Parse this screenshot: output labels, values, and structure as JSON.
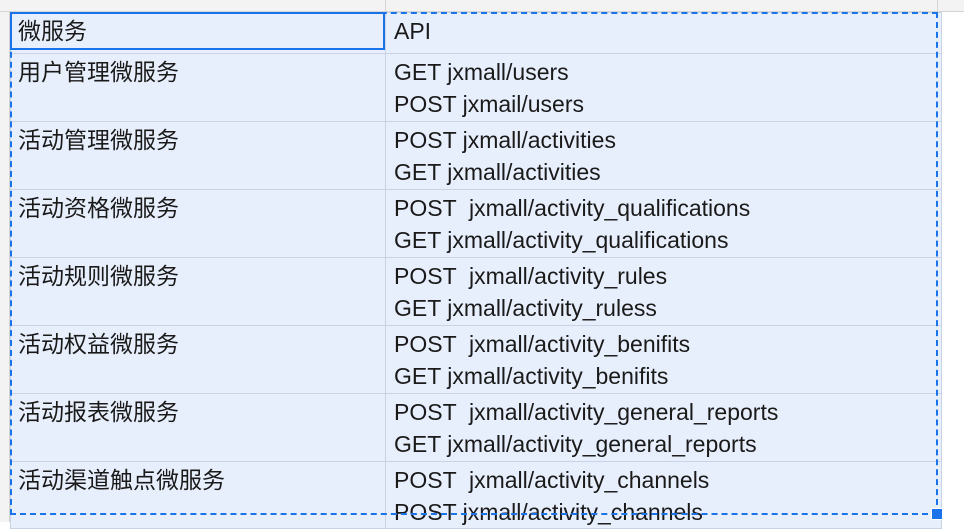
{
  "sheet": {
    "accent_color": "#1a73e8",
    "selection_fill": "#e8effc",
    "header": {
      "col_a": "微服务",
      "col_b": "API"
    },
    "rows": [
      {
        "name": "用户管理微服务",
        "apis": [
          "GET jxmall/users",
          "POST jxmail/users"
        ]
      },
      {
        "name": "活动管理微服务",
        "apis": [
          "POST jxmall/activities",
          "GET jxmall/activities"
        ]
      },
      {
        "name": "活动资格微服务",
        "apis": [
          "POST  jxmall/activity_qualifications",
          "GET jxmall/activity_qualifications"
        ]
      },
      {
        "name": "活动规则微服务",
        "apis": [
          "POST  jxmall/activity_rules",
          "GET jxmall/activity_ruless"
        ]
      },
      {
        "name": "活动权益微服务",
        "apis": [
          "POST  jxmall/activity_benifits",
          "GET jxmall/activity_benifits"
        ]
      },
      {
        "name": "活动报表微服务",
        "apis": [
          "POST  jxmall/activity_general_reports",
          "GET jxmall/activity_general_reports"
        ]
      },
      {
        "name": "活动渠道触点微服务",
        "apis": [
          "POST  jxmall/activity_channels",
          "POST jxmall/activity_channels"
        ]
      }
    ]
  }
}
